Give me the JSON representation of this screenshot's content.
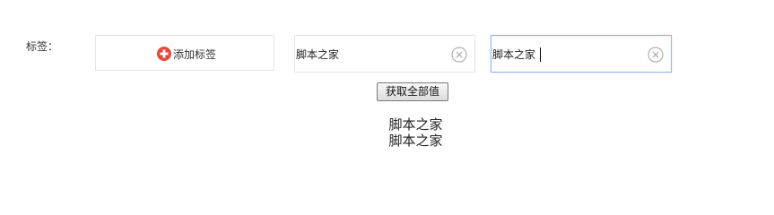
{
  "form": {
    "tag_label": "标签："
  },
  "add_tag": {
    "label": "添加标签",
    "icon": "plus-circle-icon",
    "icon_color": "#e8483b"
  },
  "tags": [
    {
      "value": "脚本之家",
      "focused": false,
      "clear_icon": "clear-circle-icon"
    },
    {
      "value": "脚本之家",
      "focused": true,
      "clear_icon": "clear-circle-icon"
    }
  ],
  "actions": {
    "get_all_label": "获取全部值"
  },
  "output": {
    "lines": [
      "脚本之家",
      "脚本之家"
    ]
  },
  "colors": {
    "focus_border": "#8fb4f0",
    "field_border": "#e6e6e6"
  }
}
